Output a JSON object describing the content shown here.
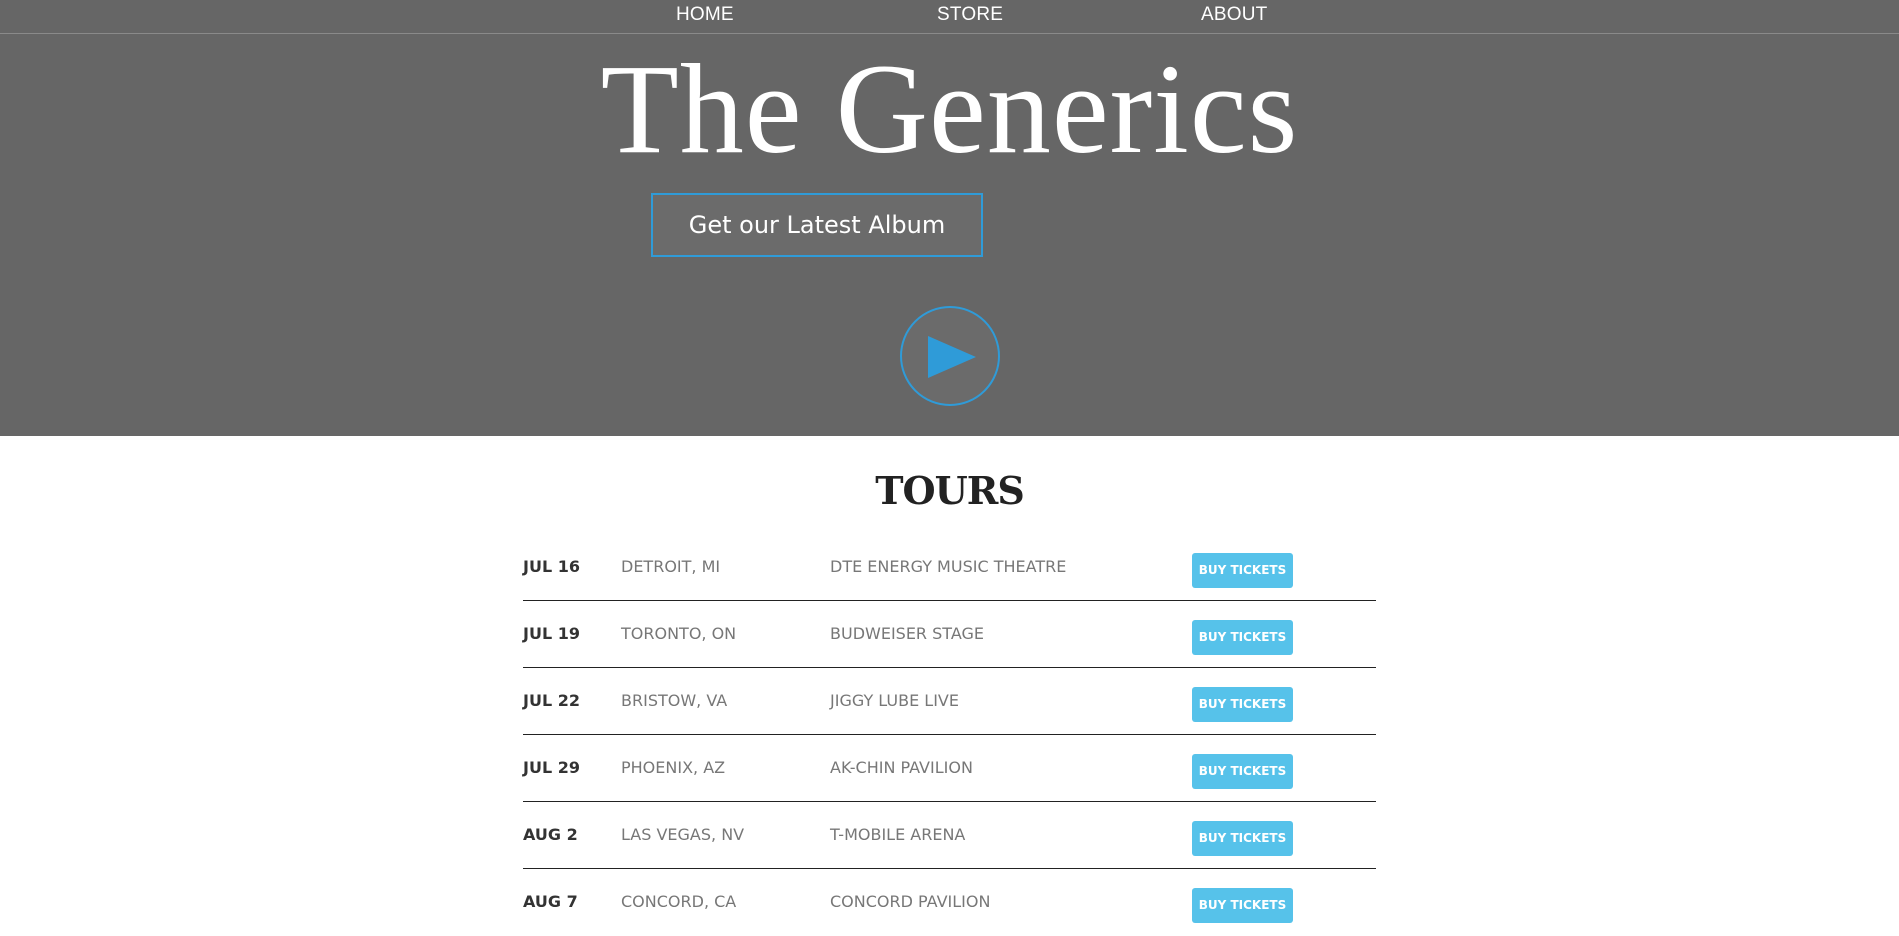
{
  "nav": {
    "home": "HOME",
    "store": "STORE",
    "about": "ABOUT"
  },
  "hero": {
    "title": "The Generics",
    "album_button": "Get our Latest Album",
    "play_icon": "play-icon"
  },
  "colors": {
    "header_bg": "#666666",
    "accent": "#2f9bd8",
    "ticket_button": "#56c2ea"
  },
  "tours": {
    "title": "TOURS",
    "rows": [
      {
        "date": "JUL 16",
        "city": "DETROIT, MI",
        "venue": "DTE ENERGY MUSIC THEATRE",
        "button": "BUY TICKETS"
      },
      {
        "date": "JUL 19",
        "city": "TORONTO, ON",
        "venue": "BUDWEISER STAGE",
        "button": "BUY TICKETS"
      },
      {
        "date": "JUL 22",
        "city": "BRISTOW, VA",
        "venue": "JIGGY LUBE LIVE",
        "button": "BUY TICKETS"
      },
      {
        "date": "JUL 29",
        "city": "PHOENIX, AZ",
        "venue": "AK-CHIN PAVILION",
        "button": "BUY TICKETS"
      },
      {
        "date": "AUG 2",
        "city": "LAS VEGAS, NV",
        "venue": "T-MOBILE ARENA",
        "button": "BUY TICKETS"
      },
      {
        "date": "AUG 7",
        "city": "CONCORD, CA",
        "venue": "CONCORD PAVILION",
        "button": "BUY TICKETS"
      }
    ]
  }
}
